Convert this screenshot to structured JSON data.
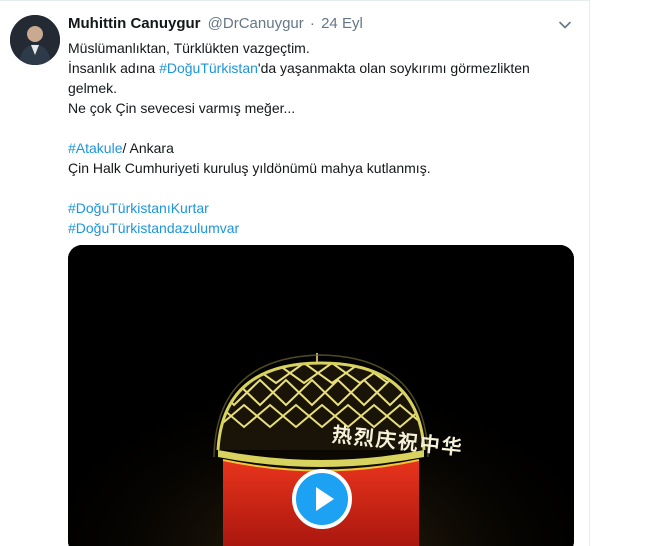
{
  "tweet": {
    "author_name": "Muhittin Canuygur",
    "author_handle": "@DrCanuygur",
    "separator": "·",
    "timestamp": "24 Eyl",
    "lines": {
      "l1": "Müslümanlıktan, Türklükten vazgeçtim.",
      "l2_pre": "İnsanlık adına ",
      "l2_tag": "#DoğuTürkistan",
      "l2_post": "'da yaşanmakta olan soykırımı görmezlikten",
      "l3": "gelmek.",
      "l4": "Ne çok Çin sevecesi varmış meğer...",
      "l5_tag": "#Atakule",
      "l5_post": "/ Ankara",
      "l6": "Çin Halk Cumhuriyeti kuruluş yıldönümü mahya kutlanmış.",
      "l7_tag": "#DoğuTürkistanıKurtar",
      "l8_tag": "#DoğuTürkistandazulumvar"
    },
    "media": {
      "overlay_text": "热烈庆祝中华",
      "play_icon": "play-icon"
    }
  },
  "colors": {
    "link": "#1b95e0",
    "play_button": "#1da1f2",
    "secondary_text": "#657786"
  }
}
